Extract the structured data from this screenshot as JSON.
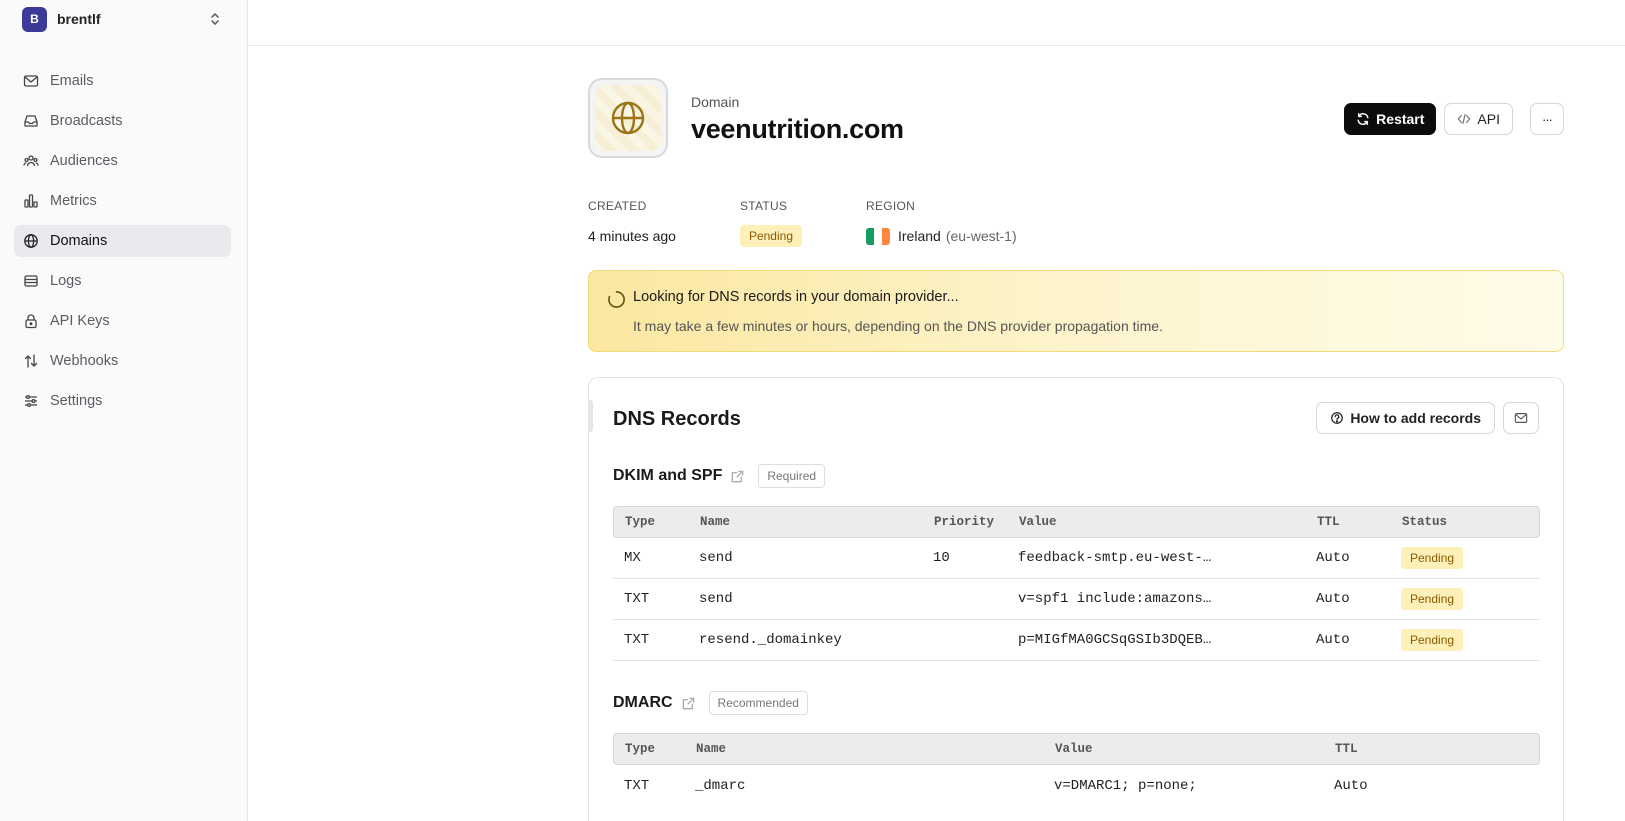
{
  "team": {
    "initial": "B",
    "name": "brentlf"
  },
  "nav": [
    {
      "label": "Emails",
      "icon": "mail-icon"
    },
    {
      "label": "Broadcasts",
      "icon": "inbox-icon"
    },
    {
      "label": "Audiences",
      "icon": "users-icon"
    },
    {
      "label": "Metrics",
      "icon": "bar-chart-icon"
    },
    {
      "label": "Domains",
      "icon": "globe-icon",
      "active": true
    },
    {
      "label": "Logs",
      "icon": "logs-icon"
    },
    {
      "label": "API Keys",
      "icon": "lock-icon"
    },
    {
      "label": "Webhooks",
      "icon": "webhook-icon"
    },
    {
      "label": "Settings",
      "icon": "sliders-icon"
    }
  ],
  "domain": {
    "kind_label": "Domain",
    "name": "veenutrition.com",
    "restart_label": "Restart",
    "api_label": "API",
    "more_label": "···"
  },
  "meta": {
    "created_label": "CREATED",
    "created_value": "4 minutes ago",
    "status_label": "STATUS",
    "status_value": "Pending",
    "region_label": "REGION",
    "region_name": "Ireland",
    "region_code": "(eu-west-1)"
  },
  "alert": {
    "title": "Looking for DNS records in your domain provider...",
    "description": "It may take a few minutes or hours, depending on the DNS provider propagation time."
  },
  "dns": {
    "title": "DNS Records",
    "how_label": "How to add records",
    "dkim": {
      "title": "DKIM and SPF",
      "tag": "Required",
      "headers": [
        "Type",
        "Name",
        "Priority",
        "Value",
        "TTL",
        "Status"
      ],
      "rows": [
        [
          "MX",
          "send",
          "10",
          "feedback-smtp.eu-west-…",
          "Auto",
          "Pending"
        ],
        [
          "TXT",
          "send",
          "",
          "v=spf1 include:amazons…",
          "Auto",
          "Pending"
        ],
        [
          "TXT",
          "resend._domainkey",
          "",
          "p=MIGfMA0GCSqGSIb3DQEB…",
          "Auto",
          "Pending"
        ]
      ]
    },
    "dmarc": {
      "title": "DMARC",
      "tag": "Recommended",
      "headers": [
        "Type",
        "Name",
        "Value",
        "TTL"
      ],
      "rows": [
        [
          "TXT",
          "_dmarc",
          "v=DMARC1; p=none;",
          "Auto"
        ]
      ]
    }
  },
  "colors": {
    "accent_dark": "#0c0c0c",
    "avatar": "#3b3a98",
    "pending_bg": "#fdf0b8",
    "pending_text": "#8a5a00",
    "alert_border": "#f1dc77",
    "globe": "#9a7416"
  }
}
